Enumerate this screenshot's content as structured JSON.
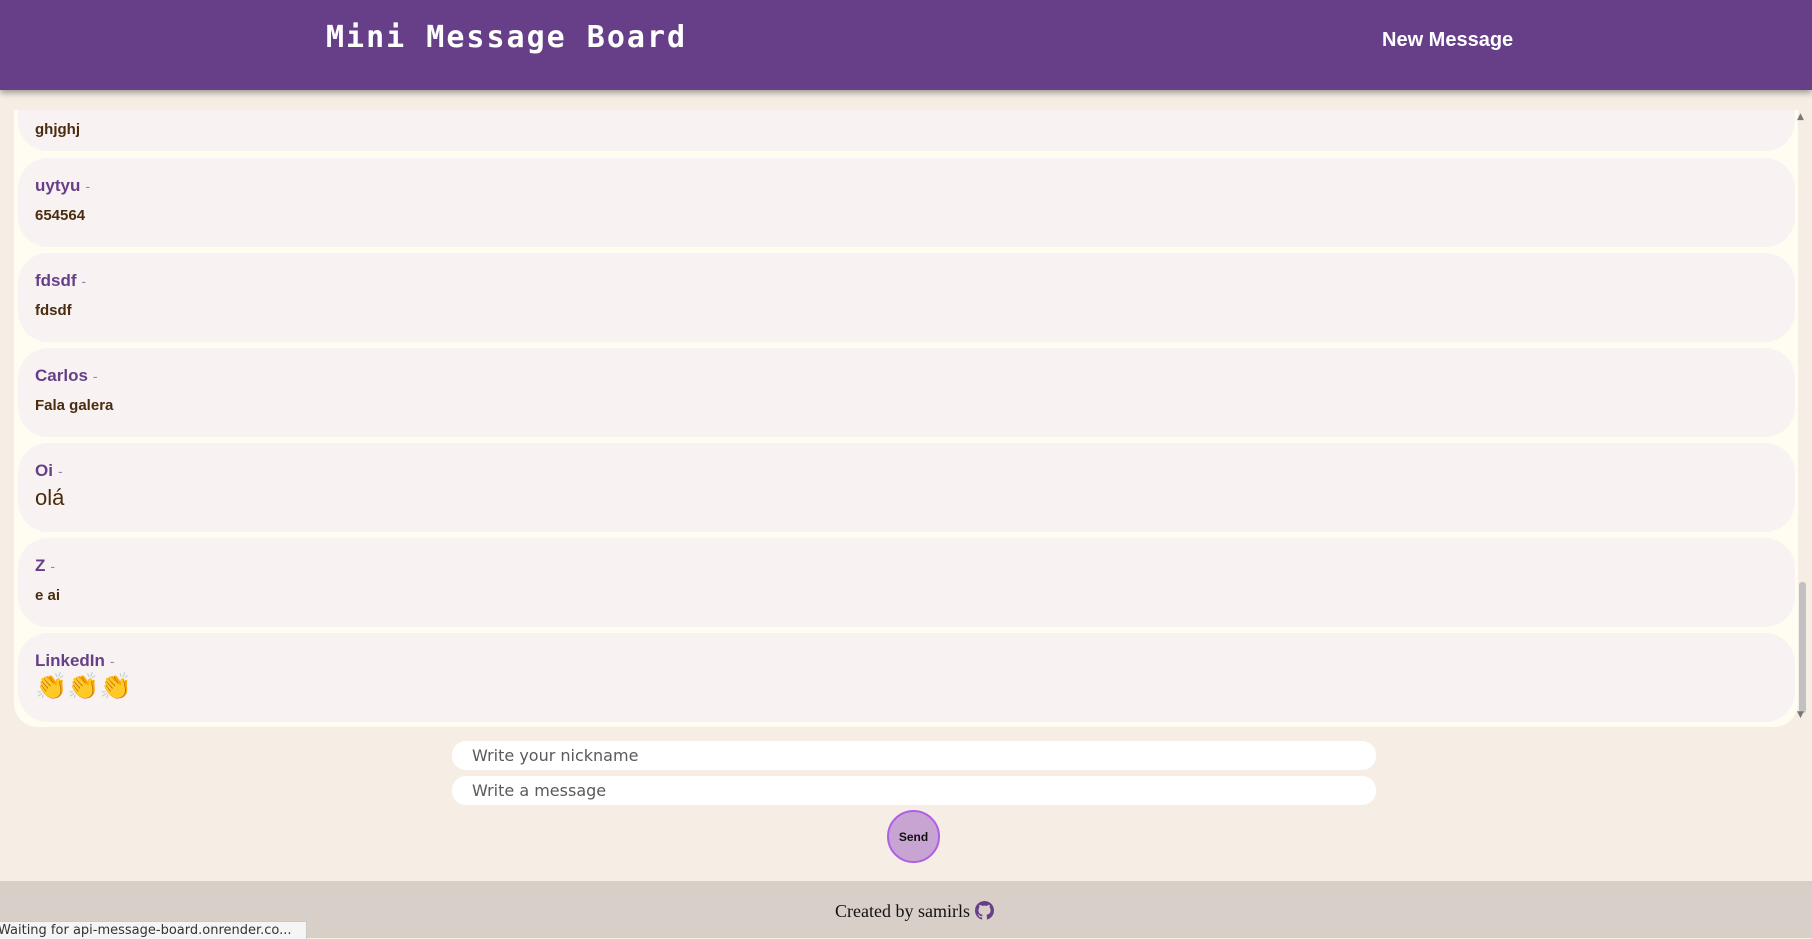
{
  "header": {
    "title": "Mini Message Board",
    "new_message_label": "New Message"
  },
  "messages": [
    {
      "author": "",
      "text": "ghjghj"
    },
    {
      "author": "uytyu",
      "text": "654564"
    },
    {
      "author": "fdsdf",
      "text": "fdsdf"
    },
    {
      "author": "Carlos",
      "text": "Fala galera"
    },
    {
      "author": "Oi",
      "text": "olá"
    },
    {
      "author": "Z",
      "text": "e ai"
    },
    {
      "author": "LinkedIn",
      "text": "👏👏👏"
    }
  ],
  "separator": "-",
  "form": {
    "nickname_placeholder": "Write your nickname",
    "message_placeholder": "Write a message",
    "send_label": "Send"
  },
  "footer": {
    "text": "Created by samirls",
    "icon": "github-icon"
  },
  "status_bar": {
    "text": "Waiting for api-message-board.onrender.co..."
  },
  "colors": {
    "header_bg": "#673f88",
    "page_bg": "#f6eee5",
    "author": "#673f88",
    "message_text": "#4a2d0e",
    "send_button": "#c7a4d2",
    "footer_bg": "#d8cfc9"
  }
}
